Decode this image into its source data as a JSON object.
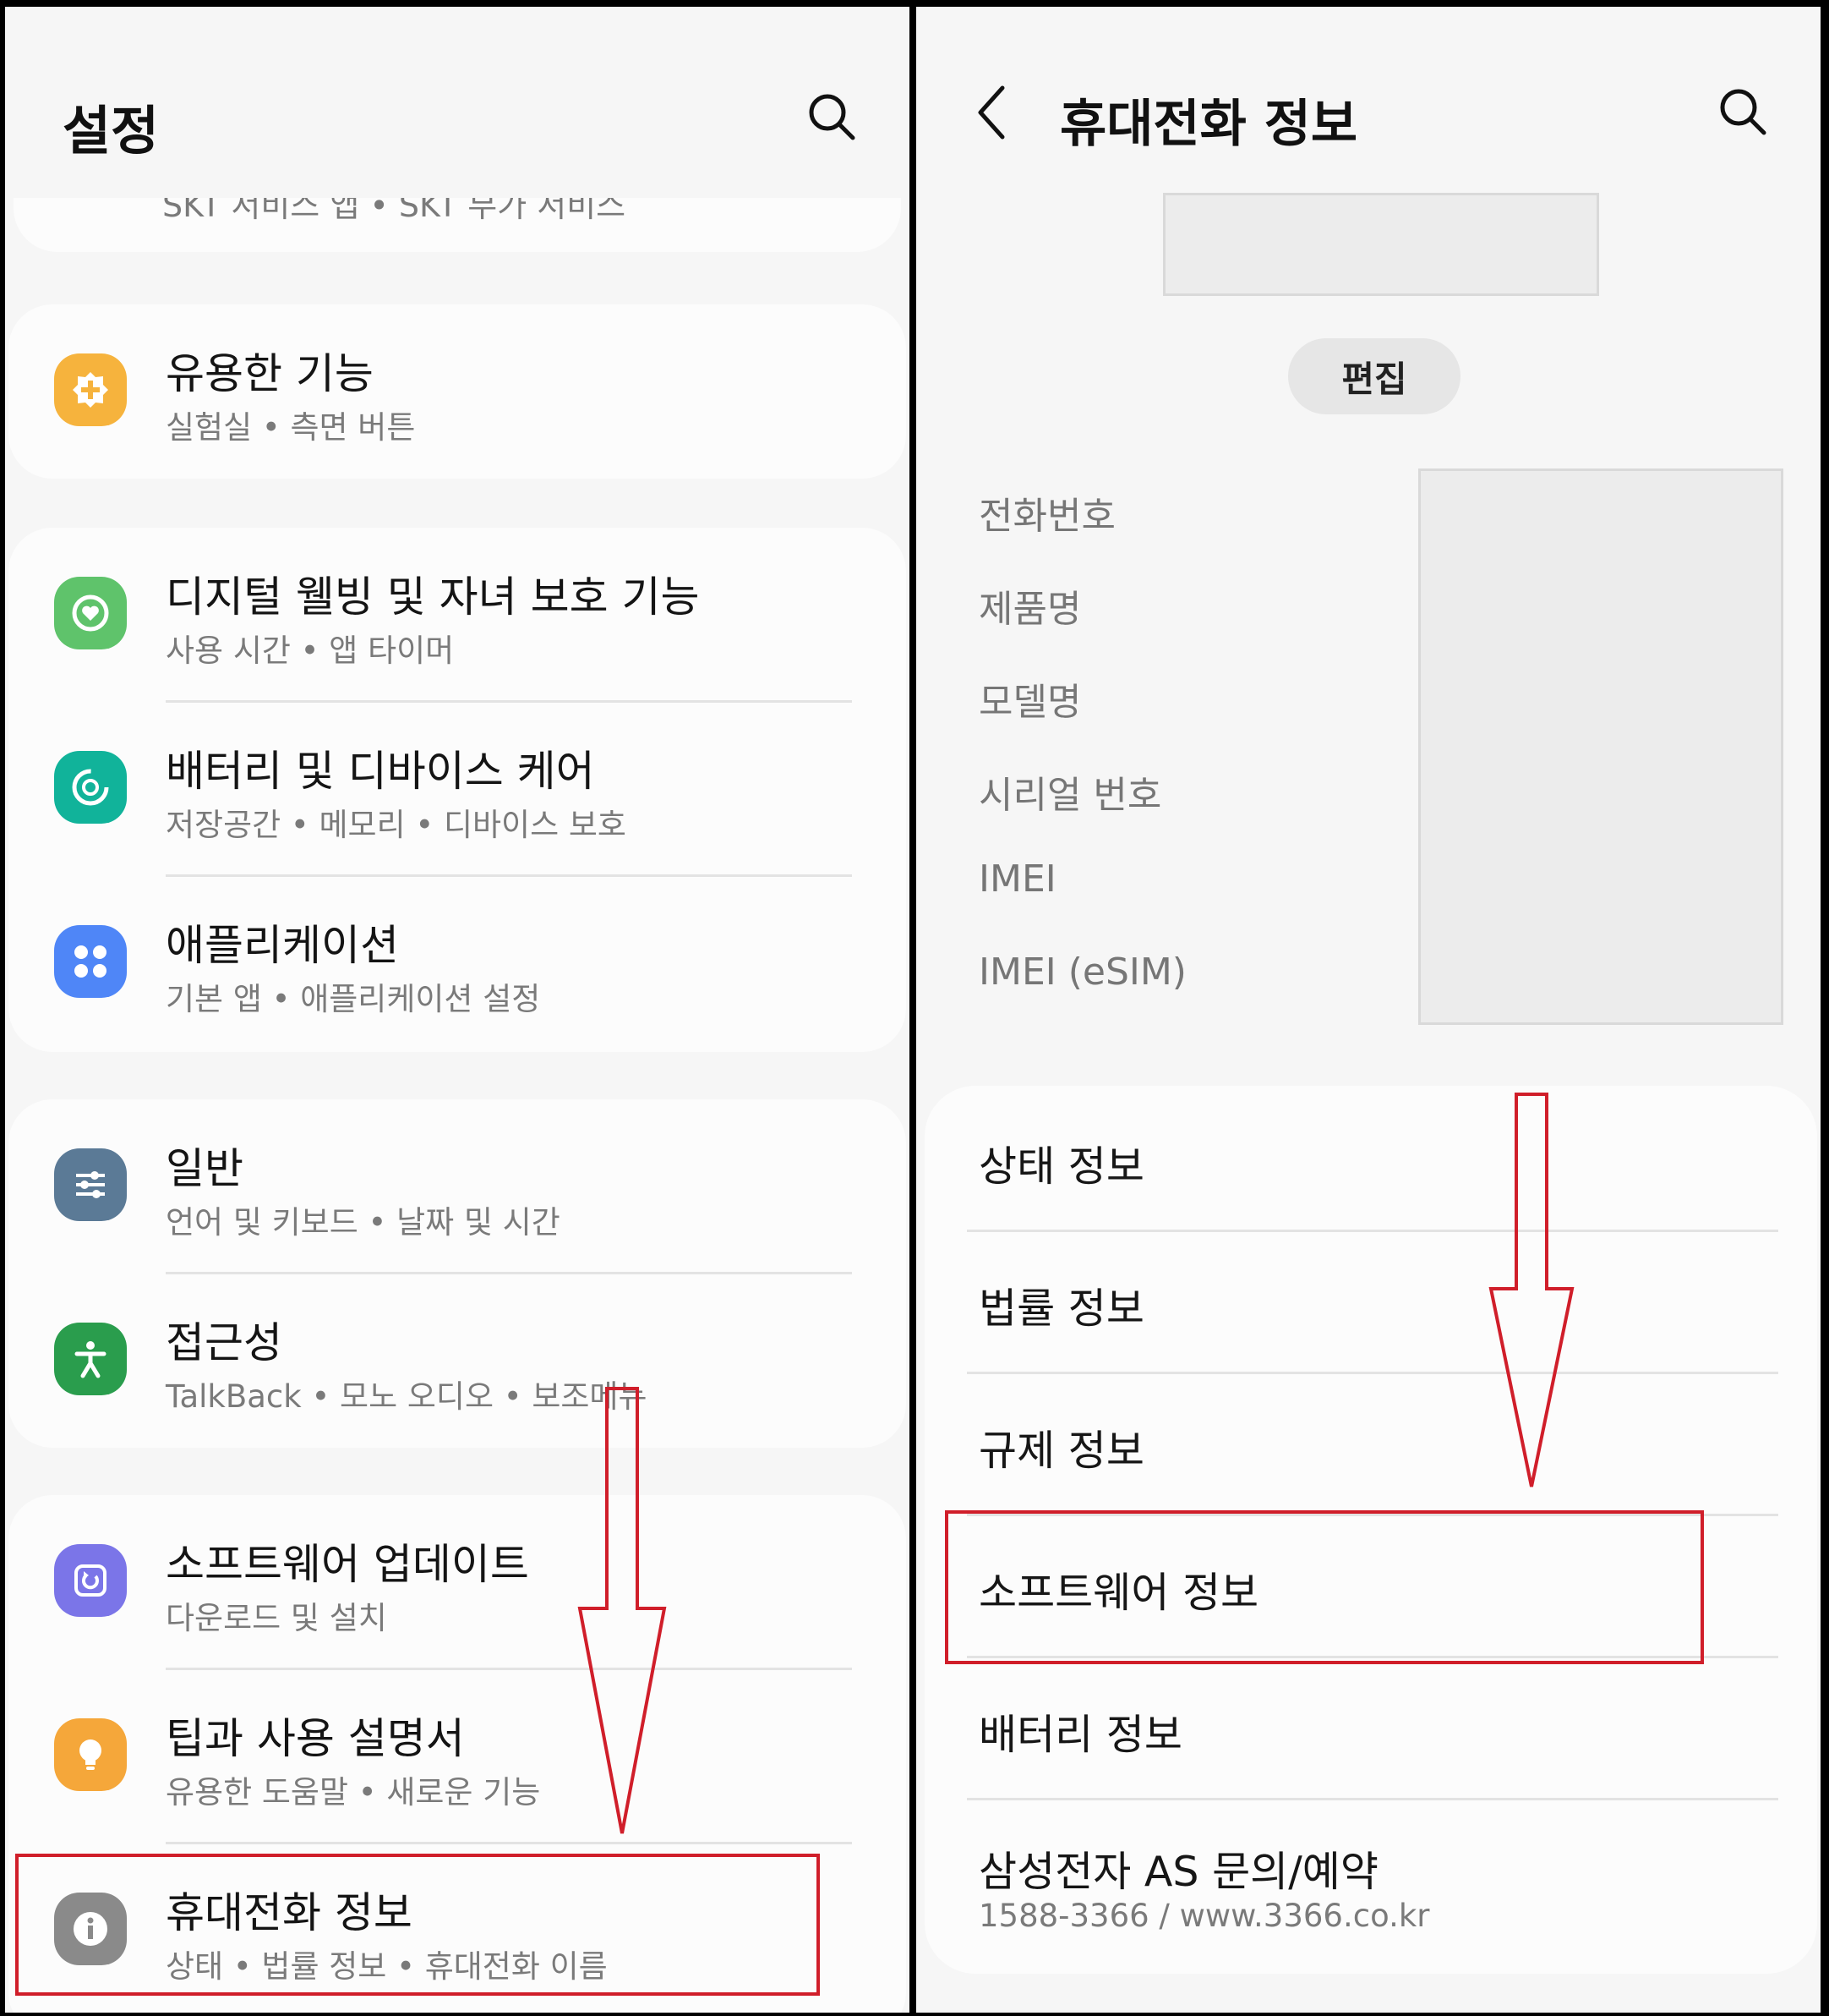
{
  "left_screen": {
    "title": "설정",
    "cutoff_item_subtitle": "SKT 서비스 앱 • SKT 부가 서비스",
    "items": [
      {
        "title": "유용한 기능",
        "subtitle": "실험실 • 측면 버튼",
        "icon": "plus-gear-icon",
        "color": "#f6b33d"
      },
      {
        "title": "디지털 웰빙 및 자녀 보호 기능",
        "subtitle": "사용 시간 • 앱 타이머",
        "icon": "heart-circle-icon",
        "color": "#5fc36b"
      },
      {
        "title": "배터리 및 디바이스 케어",
        "subtitle": "저장공간 • 메모리 • 디바이스 보호",
        "icon": "device-care-icon",
        "color": "#11b39a"
      },
      {
        "title": "애플리케이션",
        "subtitle": "기본 앱 • 애플리케이션 설정",
        "icon": "apps-grid-icon",
        "color": "#4f86f7"
      },
      {
        "title": "일반",
        "subtitle": "언어 및 키보드 • 날짜 및 시간",
        "icon": "sliders-icon",
        "color": "#5b7a96"
      },
      {
        "title": "접근성",
        "subtitle": "TalkBack • 모노 오디오 • 보조메뉴",
        "icon": "accessibility-person-icon",
        "color": "#2a9d4d"
      },
      {
        "title": "소프트웨어 업데이트",
        "subtitle": "다운로드 및 설치",
        "icon": "update-refresh-icon",
        "color": "#7b75e8"
      },
      {
        "title": "팁과 사용 설명서",
        "subtitle": "유용한 도움말 • 새로운 기능",
        "icon": "lightbulb-icon",
        "color": "#f5a73a"
      },
      {
        "title": "휴대전화 정보",
        "subtitle": "상태 • 법률 정보 • 휴대전화 이름",
        "icon": "info-icon",
        "color": "#8a8a8a"
      }
    ]
  },
  "right_screen": {
    "title": "휴대전화 정보",
    "edit_button": "편집",
    "info_labels": [
      "전화번호",
      "제품명",
      "모델명",
      "시리얼 번호",
      "IMEI",
      "IMEI (eSIM)"
    ],
    "menu": [
      {
        "title": "상태 정보"
      },
      {
        "title": "법률 정보"
      },
      {
        "title": "규제 정보"
      },
      {
        "title": "소프트웨어 정보"
      },
      {
        "title": "배터리 정보"
      },
      {
        "title": "삼성전자 AS 문의/예약",
        "subtitle": "1588-3366 / www.3366.co.kr"
      }
    ]
  },
  "colors": {
    "highlight": "#d01e2a",
    "background": "#f6f6f6",
    "card": "#fcfcfc"
  }
}
